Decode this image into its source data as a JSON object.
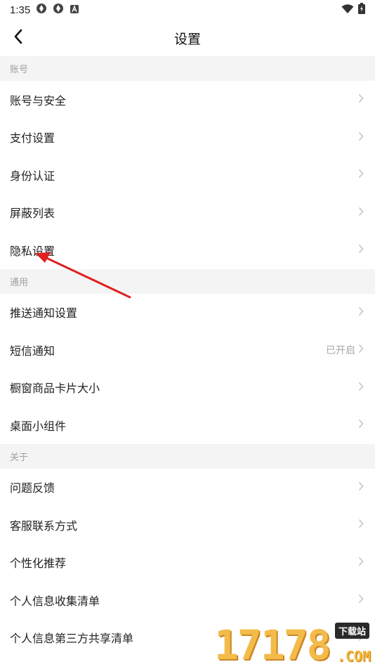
{
  "status_bar": {
    "time": "1:35",
    "left_icons": [
      "app-notification-icon",
      "app-notification-icon",
      "font-a-icon"
    ],
    "right_icons": [
      "wifi-icon",
      "battery-charging-icon"
    ]
  },
  "header": {
    "title": "设置",
    "back_icon": "back-chevron-icon"
  },
  "sections": [
    {
      "header": "账号",
      "items": [
        {
          "label": "账号与安全"
        },
        {
          "label": "支付设置"
        },
        {
          "label": "身份认证"
        },
        {
          "label": "屏蔽列表"
        },
        {
          "label": "隐私设置"
        }
      ]
    },
    {
      "header": "通用",
      "items": [
        {
          "label": "推送通知设置"
        },
        {
          "label": "短信通知",
          "value": "已开启"
        },
        {
          "label": "橱窗商品卡片大小"
        },
        {
          "label": "桌面小组件"
        }
      ]
    },
    {
      "header": "关于",
      "items": [
        {
          "label": "问题反馈"
        },
        {
          "label": "客服联系方式"
        },
        {
          "label": "个性化推荐"
        },
        {
          "label": "个人信息收集清单"
        },
        {
          "label": "个人信息第三方共享清单"
        }
      ]
    }
  ],
  "annotation": {
    "arrow_color": "#e02020"
  },
  "watermark": {
    "number": "17178",
    "badge": "下载站",
    "domain": ".COM"
  },
  "colors": {
    "section_bg": "#f4f4f5",
    "section_text": "#a0a0a0",
    "chevron": "#c4c4c4",
    "value_text": "#a8a8a8"
  }
}
